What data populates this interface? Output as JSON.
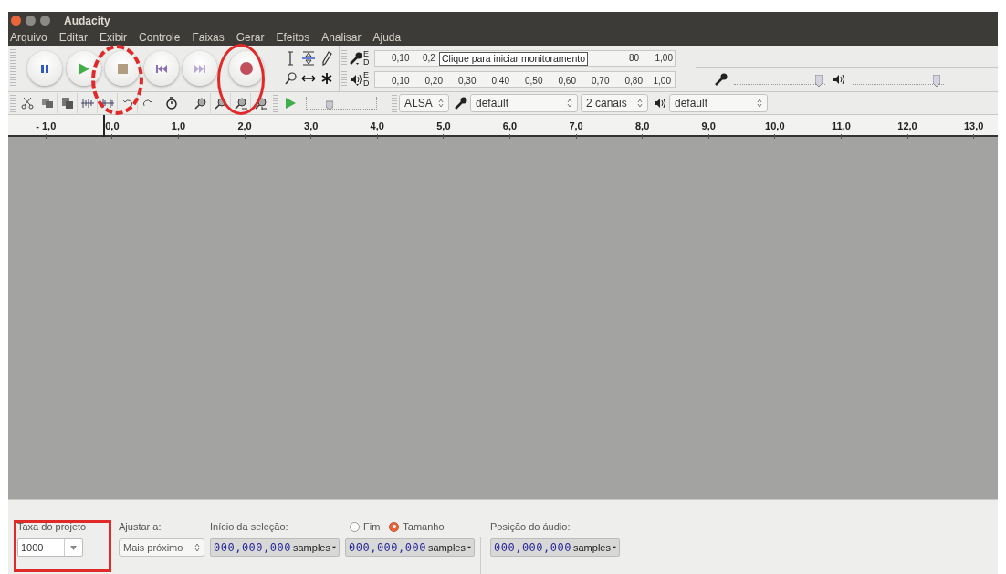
{
  "window": {
    "title": "Audacity"
  },
  "menu": [
    "Arquivo",
    "Editar",
    "Exibir",
    "Controle",
    "Faixas",
    "Gerar",
    "Efeitos",
    "Analisar",
    "Ajuda"
  ],
  "transport": [
    {
      "kind": "pause"
    },
    {
      "kind": "play"
    },
    {
      "kind": "stop"
    },
    {
      "kind": "skip-start"
    },
    {
      "kind": "skip-end"
    },
    {
      "kind": "record"
    }
  ],
  "annotations": [
    {
      "kind": "dashed-ellipse"
    },
    {
      "kind": "ellipse"
    },
    {
      "kind": "box"
    }
  ],
  "record_meter": {
    "channels": [
      "E",
      "D"
    ],
    "ticks_before": [
      "0,10",
      "0,2"
    ],
    "tooltip": "Clique para iniciar monitoramento",
    "ticks_after": [
      "80",
      "1,00"
    ]
  },
  "playback_meter": {
    "channels": [
      "E",
      "D"
    ],
    "ticks": [
      "0,10",
      "0,20",
      "0,30",
      "0,40",
      "0,50",
      "0,60",
      "0,70",
      "0,80",
      "1,00"
    ]
  },
  "mixer": {
    "record_volume": {
      "level": 0.97
    },
    "playback_volume": {
      "level": 0.96
    }
  },
  "play_at_speed": {
    "level": 0.3
  },
  "device": {
    "host": "ALSA",
    "input": "default",
    "channels": "2 canais",
    "output": "default"
  },
  "ruler": [
    "- 1,0",
    "0,0",
    "1,0",
    "2,0",
    "3,0",
    "4,0",
    "5,0",
    "6,0",
    "7,0",
    "8,0",
    "9,0",
    "10,0",
    "11,0",
    "12,0",
    "13,0"
  ],
  "selection_bar": {
    "project_rate": {
      "label": "Taxa do projeto",
      "value": "1000"
    },
    "snap": {
      "label": "Ajustar a:",
      "value": "Mais próximo"
    },
    "start": {
      "label": "Início da seleção:",
      "value": "000,000,000",
      "unit": "samples"
    },
    "end_or_length": {
      "options": [
        {
          "label": "Fim",
          "selected": false
        },
        {
          "label": "Tamanho",
          "selected": true
        }
      ],
      "value": "000,000,000",
      "unit": "samples"
    },
    "audio_position": {
      "label": "Posição do áudio:",
      "value": "000,000,000",
      "unit": "samples"
    }
  }
}
